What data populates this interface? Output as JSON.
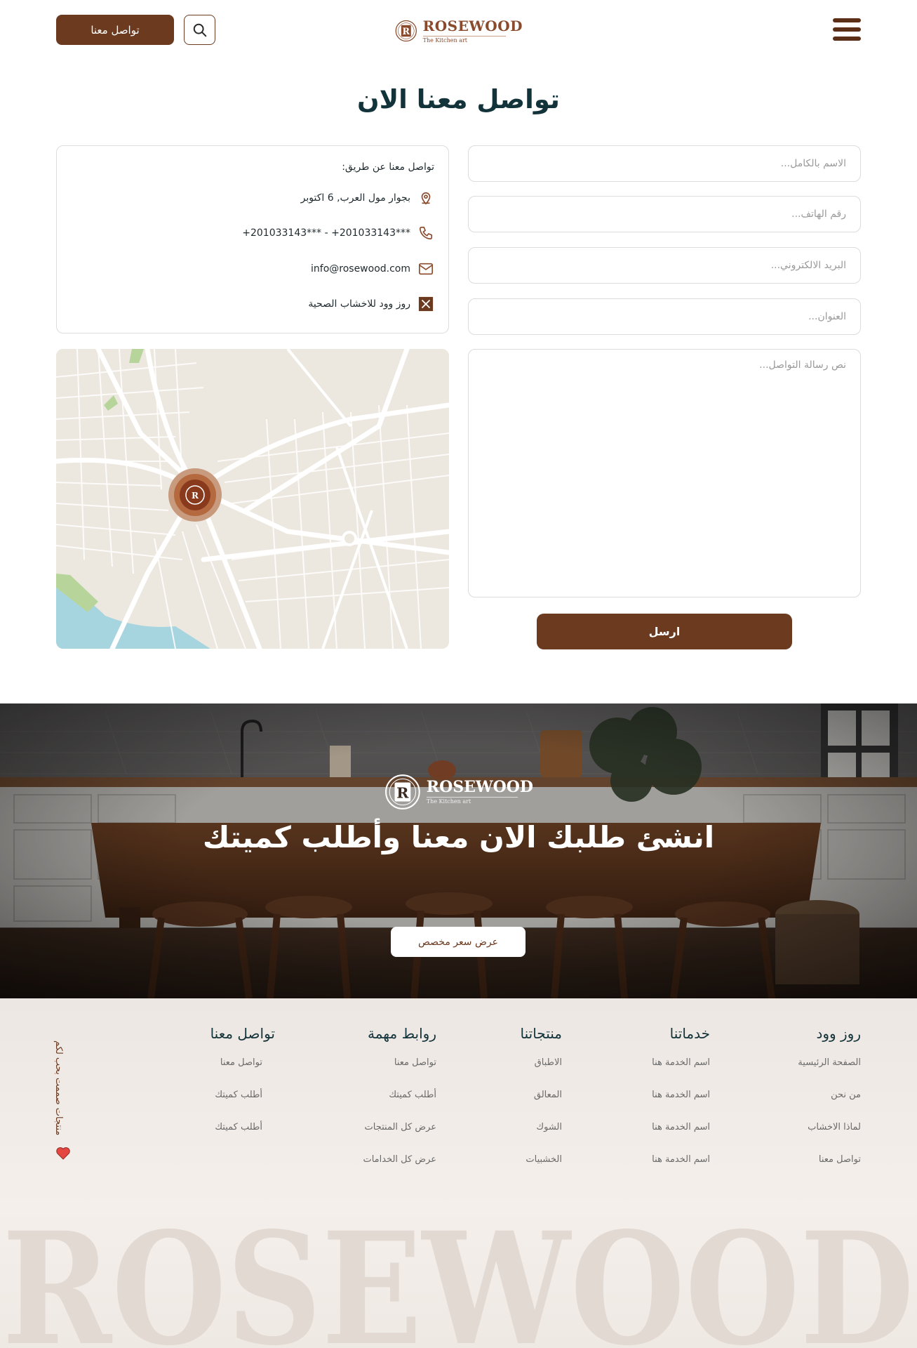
{
  "header": {
    "contact_label": "تواصل معنا",
    "logo": {
      "brand": "ROSEWOOD",
      "tagline": "The Kitchen art"
    }
  },
  "title": "تواصل معنا الان",
  "form": {
    "fullname_placeholder": "الاسم بالكامل...",
    "phone_placeholder": "رقم الهاتف...",
    "email_placeholder": "البريد الالكتروني...",
    "address_placeholder": "العنوان...",
    "message_placeholder": "نص رسالة التواصل...",
    "send_label": "ارسل"
  },
  "contact_card": {
    "title": "تواصل معنا عن طريق:",
    "address": "بجوار مول العرب, 6 اكتوبر",
    "phones": "+201033143***  -  +201033143***",
    "email": "info@rosewood.com",
    "x_handle": "روز وود للاخشاب الصحية"
  },
  "banner": {
    "brand": "ROSEWOOD",
    "tagline": "The Kitchen art",
    "title": "انشئ طلبك الان معنا وأطلب كميتك",
    "button_label": "عرض سعر مخصص"
  },
  "footer": {
    "columns": [
      {
        "heading": "روز وود",
        "links": [
          "الصفحة الرئيسية",
          "من نحن",
          "لماذا الاخشاب",
          "تواصل معنا"
        ]
      },
      {
        "heading": "خدماتنا",
        "links": [
          "اسم الخدمة هنا",
          "اسم الخدمة هنا",
          "اسم الخدمة هنا",
          "اسم الخدمة هنا"
        ]
      },
      {
        "heading": "منتجاتنا",
        "links": [
          "الاطباق",
          "المعالق",
          "الشوك",
          "الخشبيات"
        ]
      },
      {
        "heading": "روابط مهمة",
        "links": [
          "تواصل معنا",
          "أطلب كميتك",
          "عرض كل المنتجات",
          "عرض كل الخدامات"
        ]
      },
      {
        "heading": "تواصل معنا",
        "links": [
          "تواصل معنا",
          "أطلب كميتك",
          "أطلب كميتك"
        ]
      }
    ],
    "love_text": "منتجات صممت بحب لكم",
    "watermark": "ROSEWOOD"
  },
  "colors": {
    "brand_brown": "#6b3a1f",
    "heading_teal": "#13333a",
    "logo_copper": "#8a4a2c",
    "heart_red": "#e4473f"
  },
  "icons": [
    "search-icon",
    "hamburger-menu-icon",
    "location-pin-icon",
    "phone-icon",
    "mail-icon",
    "x-logo-icon",
    "heart-icon",
    "map-marker-icon"
  ]
}
